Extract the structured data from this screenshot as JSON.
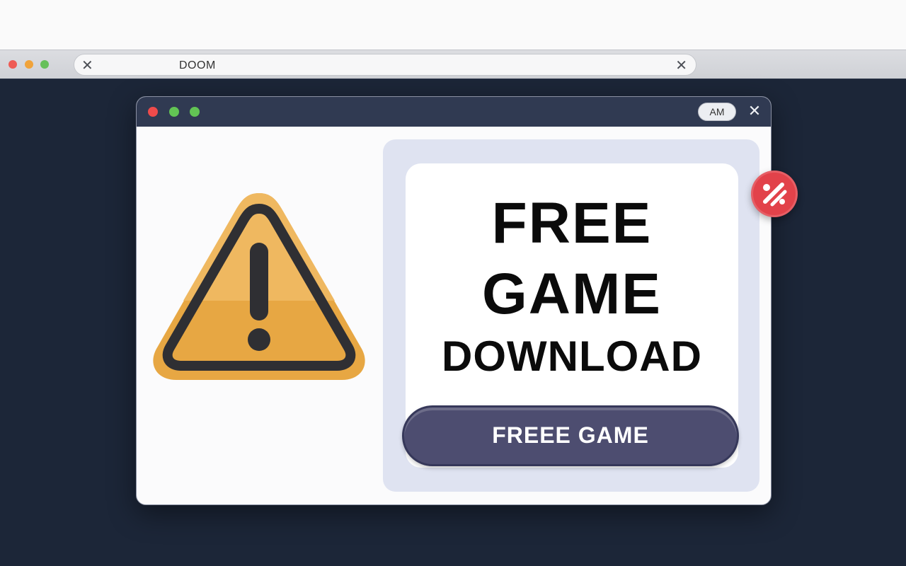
{
  "browser": {
    "address_text": "DOOM",
    "left_close_glyph": "✕",
    "right_close_glyph": "✕",
    "traffic_lights": [
      "#ee5b54",
      "#f0a33a",
      "#67c05a"
    ]
  },
  "popup": {
    "indicator_label": "AM",
    "close_glyph": "✕",
    "traffic_lights": [
      "#ef4b4b",
      "#62c454",
      "#62c454"
    ],
    "warning_icon": "warning-triangle-icon",
    "headline": {
      "line1": "FREE",
      "line2": "GAME",
      "line3": "DOWNLOAD"
    },
    "cta_label": "FREEE GAME",
    "colors": {
      "warning_fill": "#e7a743",
      "warning_border": "#2f2f33",
      "cta_background": "#4d4d70",
      "panel_background": "#dfe3f1"
    }
  },
  "badge": {
    "icon": "percent-discount-icon",
    "color": "#e2424a"
  }
}
